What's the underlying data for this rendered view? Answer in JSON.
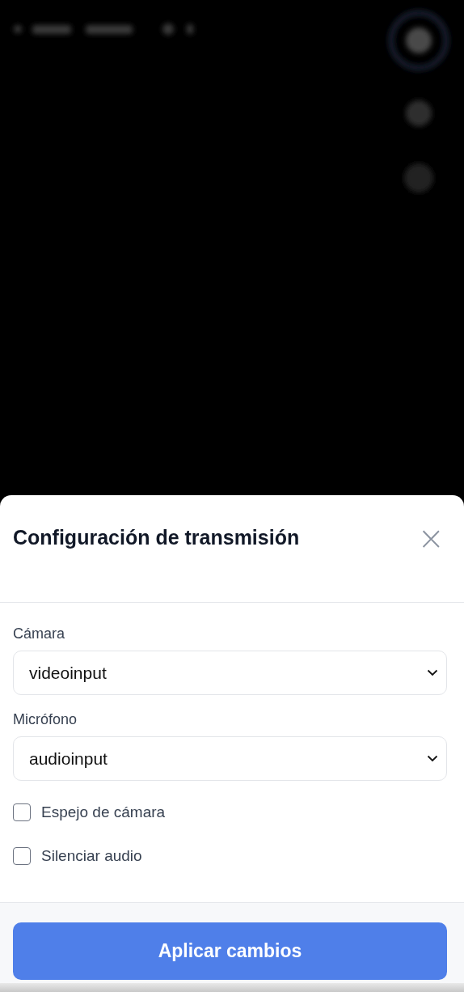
{
  "dialog": {
    "title": "Configuración de transmisión",
    "close_label": "×"
  },
  "fields": [
    {
      "label": "Cámara",
      "value": "videoinput"
    },
    {
      "label": "Micrófono",
      "value": "audioinput"
    }
  ],
  "options": [
    {
      "label": "Espejo de cámara",
      "checked": false
    },
    {
      "label": "Silenciar audio",
      "checked": false
    }
  ],
  "primary_button": "Aplicar cambios"
}
